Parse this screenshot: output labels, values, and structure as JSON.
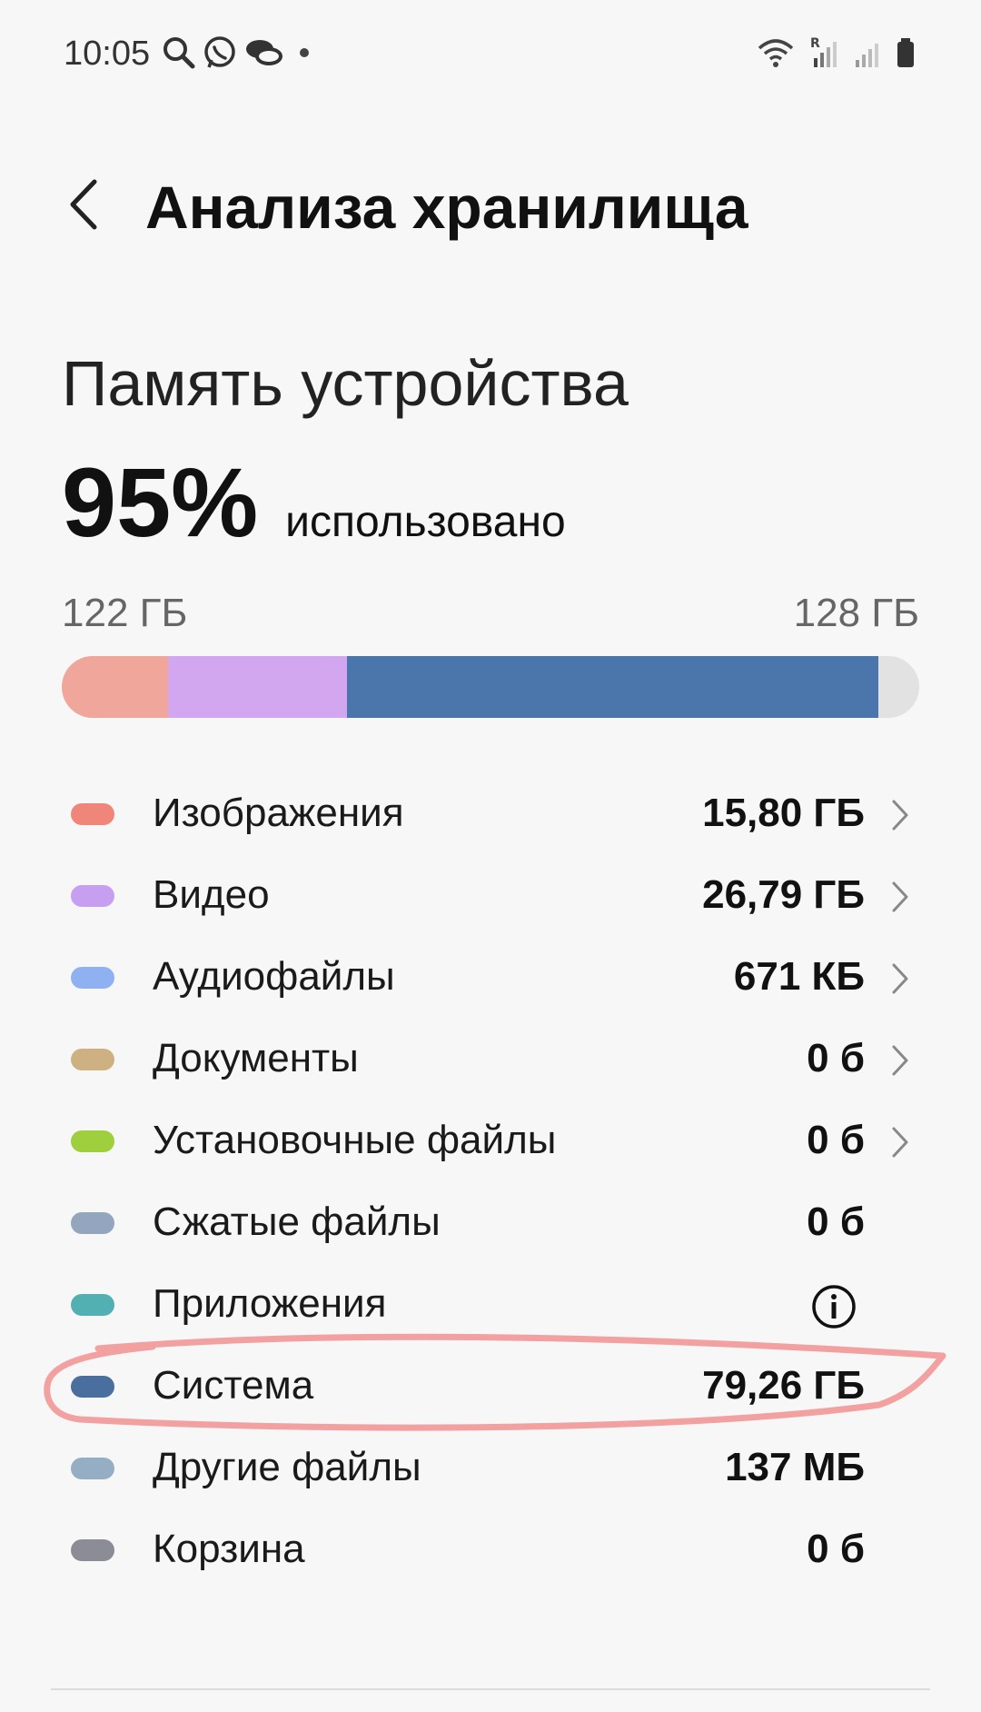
{
  "status_bar": {
    "time": "10:05",
    "left_icons": [
      "search-icon",
      "whatsapp-icon",
      "chat-bubbles-icon",
      "notification-dot-icon"
    ],
    "right_icons": [
      "wifi-icon",
      "signal-roaming-icon",
      "signal-icon",
      "battery-icon"
    ]
  },
  "header": {
    "title": "Анализа хранилища",
    "back_icon": "chevron-left-icon"
  },
  "storage": {
    "section_title": "Память устройства",
    "percent": "95%",
    "percent_label": "использовано",
    "used": "122 ГБ",
    "total": "128 ГБ",
    "usage_fraction": 0.95
  },
  "categories": [
    {
      "label": "Изображения",
      "value": "15,80 ГБ",
      "color": "#f0857a",
      "action": "chevron"
    },
    {
      "label": "Видео",
      "value": "26,79 ГБ",
      "color": "#c79ff0",
      "action": "chevron"
    },
    {
      "label": "Аудиофайлы",
      "value": "671 КБ",
      "color": "#8fb1f2",
      "action": "chevron"
    },
    {
      "label": "Документы",
      "value": "0 б",
      "color": "#cdb183",
      "action": "chevron"
    },
    {
      "label": "Установочные файлы",
      "value": "0 б",
      "color": "#9fcf3c",
      "action": "chevron"
    },
    {
      "label": "Сжатые файлы",
      "value": "0 б",
      "color": "#93a6bd",
      "action": "none"
    },
    {
      "label": "Приложения",
      "value": "",
      "color": "#52b0b3",
      "action": "info"
    },
    {
      "label": "Система",
      "value": "79,26 ГБ",
      "color": "#4a6f9e",
      "action": "none"
    },
    {
      "label": "Другие файлы",
      "value": "137 МБ",
      "color": "#95aec4",
      "action": "none"
    },
    {
      "label": "Корзина",
      "value": "0 б",
      "color": "#8c8c96",
      "action": "none"
    }
  ],
  "bar_segments": [
    {
      "name": "images",
      "color": "#f0a69a",
      "gb": 15.8
    },
    {
      "name": "video",
      "color": "#d3a7f0",
      "gb": 26.79
    },
    {
      "name": "system",
      "color": "#4a76ab",
      "gb": 79.26
    }
  ],
  "colors": {
    "highlight_stroke": "#f2a0a0",
    "bar_track": "#e2e2e2"
  }
}
